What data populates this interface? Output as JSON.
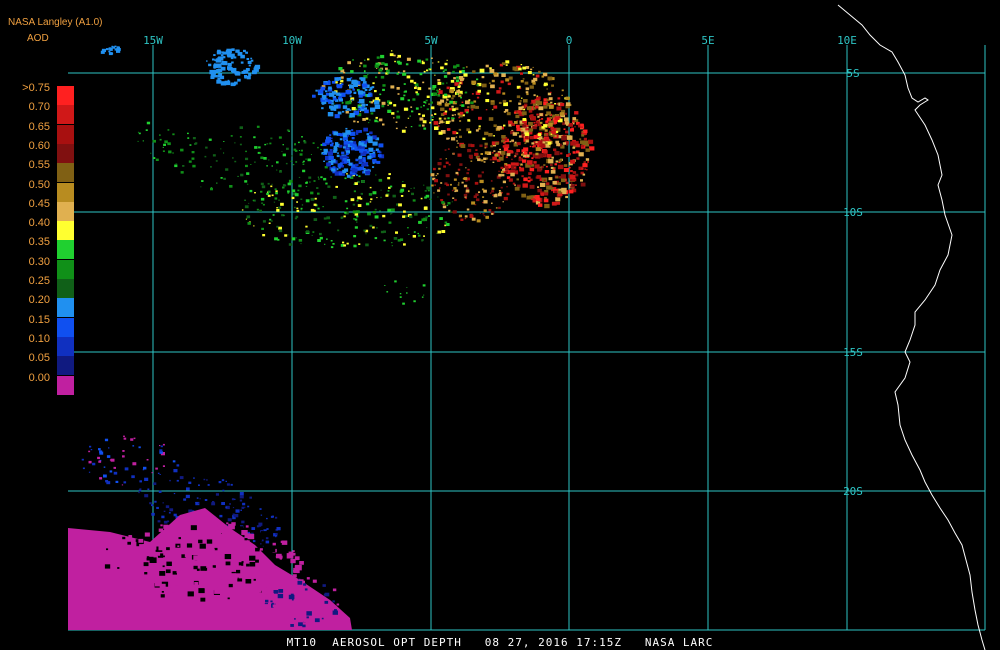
{
  "header": {
    "provider": "NASA Langley (A1.0)",
    "variable": "AOD"
  },
  "caption": "MT10  AEROSOL OPT DEPTH   08 27, 2016 17:15Z   NASA LARC",
  "grid": {
    "lon_labels": [
      "15W",
      "10W",
      "5W",
      "0",
      "5E",
      "10E"
    ],
    "lat_labels": [
      "5S",
      "10S",
      "15S",
      "20S"
    ],
    "color": "#2ec4c4"
  },
  "legend": {
    "labels": [
      ">0.75",
      "0.70",
      "0.65",
      "0.60",
      "0.55",
      "0.50",
      "0.45",
      "0.40",
      "0.35",
      "0.30",
      "0.25",
      "0.20",
      "0.15",
      "0.10",
      "0.05",
      "0.00"
    ],
    "colors": [
      "#ff2020",
      "#d01818",
      "#a81010",
      "#801010",
      "#806014",
      "#b88c20",
      "#e0b050",
      "#ffff30",
      "#20d030",
      "#109018",
      "#106018",
      "#2090f0",
      "#1050f0",
      "#1030c0",
      "#101a80",
      "#c020a0"
    ]
  },
  "colors": {
    "coastline": "#ffffff",
    "text": "#f0a040",
    "background": "#000000"
  }
}
